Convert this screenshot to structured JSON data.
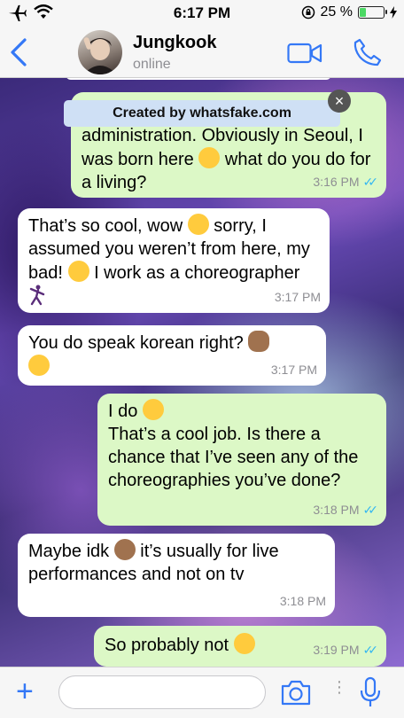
{
  "status_bar": {
    "time": "6:17 PM",
    "battery": "25 %",
    "battery_level": 0.25
  },
  "header": {
    "name": "Jungkook",
    "status": "online"
  },
  "watermark": {
    "text": "Created by whatsfake.com",
    "close": "×"
  },
  "messages": [
    {
      "dir": "out",
      "text": "administration. Obviously in Seoul, I was born here",
      "emoji_after": "winking-face",
      "text2": "what do you do for a living?",
      "time": "3:16 PM",
      "ticks": "✓✓"
    },
    {
      "dir": "in",
      "text": "That’s so cool, wow",
      "emoji1": "grinning-face",
      "text2": "sorry, I assumed you weren’t from here, my bad!",
      "emoji2": "hugging-face",
      "text3": "I work as a choreographer",
      "emoji3": "dancer",
      "time": "3:17 PM"
    },
    {
      "dir": "in",
      "text": "You do speak korean right?",
      "emoji1": "see-no-evil-monkey",
      "emoji2": "tears-of-joy-face",
      "time": "3:17 PM"
    },
    {
      "dir": "out",
      "text": "I do",
      "emoji1": "sunglasses-face",
      "text2": "That’s a cool job. Is there a chance that I’ve seen any of the choreographies you’ve done?",
      "time": "3:18 PM",
      "ticks": "✓✓"
    },
    {
      "dir": "in",
      "text": "Maybe idk",
      "emoji1": "shrug",
      "text2": "it’s usually for live performances and not on tv",
      "time": "3:18 PM"
    },
    {
      "dir": "out",
      "text": "So probably not",
      "emoji1": "sweat-smile-face",
      "time": "3:19 PM",
      "ticks": "✓✓"
    }
  ],
  "input": {
    "placeholder": "",
    "value": "",
    "colors": {
      "accent": "#3478f6",
      "out_bubble": "#dcf8c6",
      "ticks": "#34b7f1"
    }
  }
}
